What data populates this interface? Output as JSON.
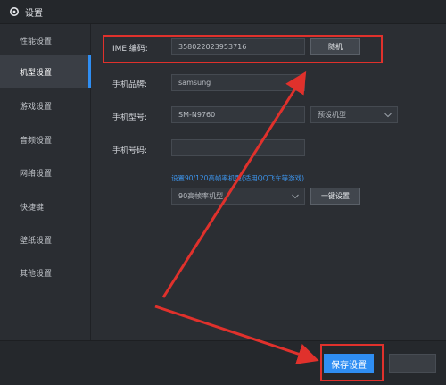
{
  "window": {
    "title": "设置"
  },
  "sidebar": {
    "items": [
      {
        "label": "性能设置"
      },
      {
        "label": "机型设置"
      },
      {
        "label": "游戏设置"
      },
      {
        "label": "音频设置"
      },
      {
        "label": "网络设置"
      },
      {
        "label": "快捷键"
      },
      {
        "label": "壁纸设置"
      },
      {
        "label": "其他设置"
      }
    ],
    "active_index": 1
  },
  "form": {
    "imei": {
      "label": "IMEI编码:",
      "value": "358022023953716",
      "random_button": "随机"
    },
    "brand": {
      "label": "手机品牌:",
      "value": "samsung"
    },
    "model": {
      "label": "手机型号:",
      "value": "SM-N9760",
      "preset_placeholder": "预设机型"
    },
    "phone": {
      "label": "手机号码:",
      "value": ""
    },
    "high_fps": {
      "hint": "设置90/120高帧率机型(适用QQ飞车等游戏)",
      "selected": "90高帧率机型",
      "one_click_button": "一键设置"
    }
  },
  "footer": {
    "save_button": "保存设置",
    "secondary_button": ""
  },
  "colors": {
    "accent": "#2f8ef3",
    "annotation": "#e0312c"
  }
}
